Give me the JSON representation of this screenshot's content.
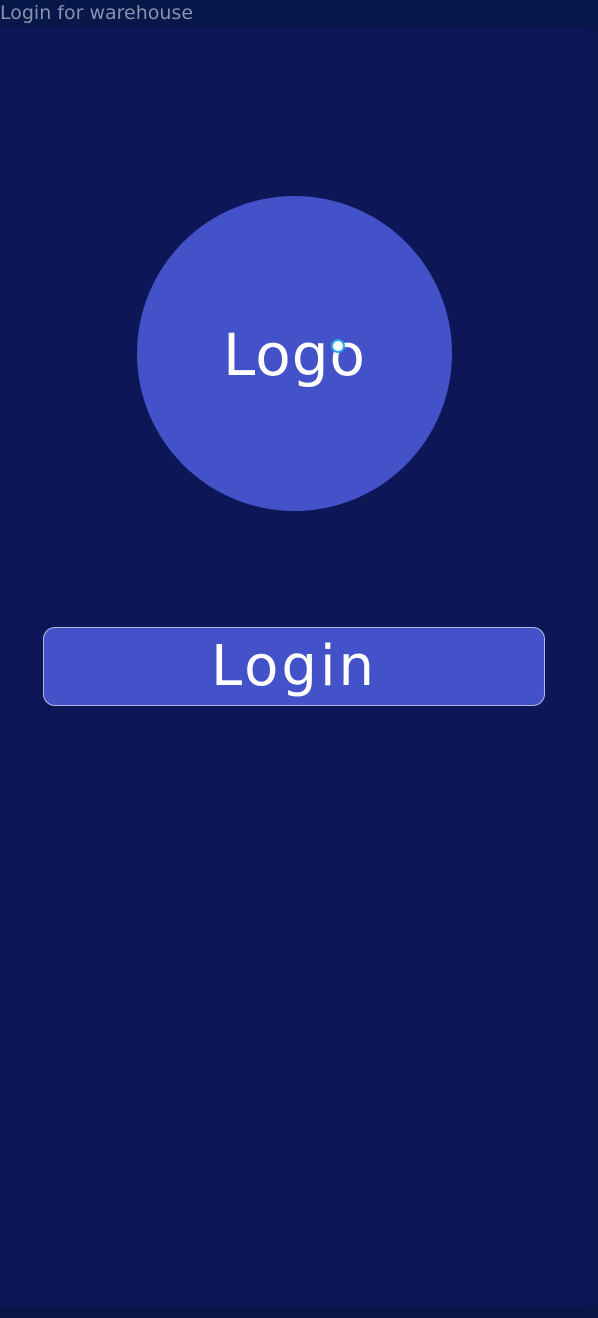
{
  "frame": {
    "label": "Login for warehouse"
  },
  "logo": {
    "text": "Logo"
  },
  "login_button": {
    "label": "Login"
  },
  "colors": {
    "background": "#0d1757",
    "accent": "#4352c9",
    "button_border": "#b4b9e0",
    "text": "#ffffff",
    "frame_label": "#8791ad",
    "selection_handle": "#29a8f0"
  }
}
